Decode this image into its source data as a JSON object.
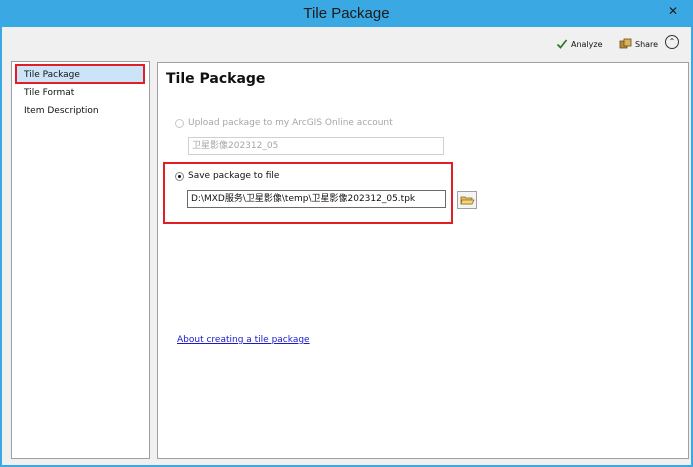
{
  "window": {
    "title": "Tile Package",
    "close_glyph": "✕"
  },
  "toolbar": {
    "analyze_label": "Analyze",
    "share_label": "Share",
    "collapse_glyph": "⌃"
  },
  "sidebar": {
    "items": [
      {
        "label": "Tile Package",
        "selected": true
      },
      {
        "label": "Tile Format",
        "selected": false
      },
      {
        "label": "Item Description",
        "selected": false
      }
    ]
  },
  "main": {
    "title": "Tile Package",
    "upload_option": {
      "label": "Upload package to my ArcGIS Online account",
      "value": "卫星影像202312_05",
      "enabled": false
    },
    "save_option": {
      "label": "Save package to file",
      "value": "D:\\MXD服务\\卫星影像\\temp\\卫星影像202312_05.tpk",
      "selected": true
    },
    "about_link": "About creating a tile package"
  },
  "colors": {
    "titlebar": "#3aa8e3",
    "highlight": "#e01e24",
    "selection": "#cce4f7",
    "link": "#1a1acc"
  }
}
